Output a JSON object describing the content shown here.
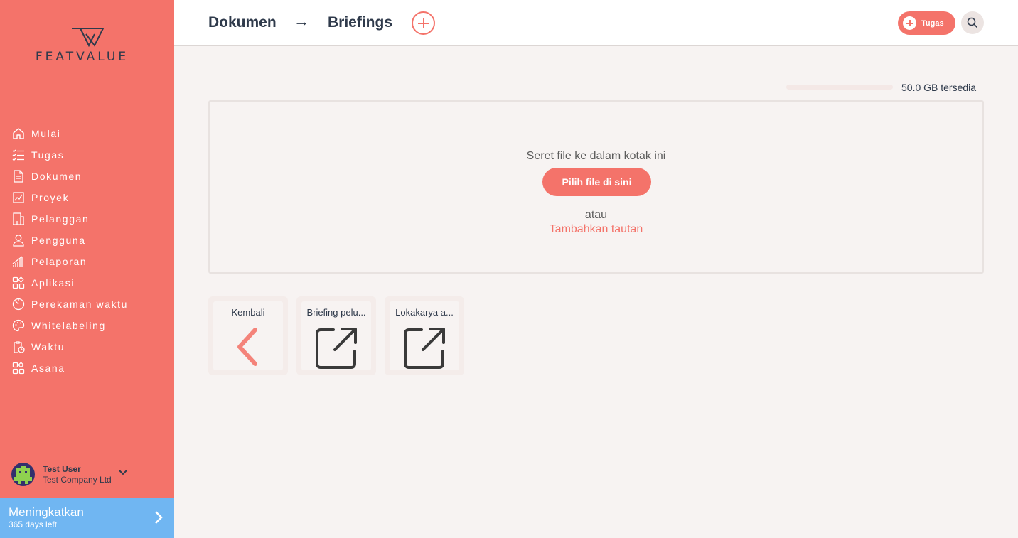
{
  "app": {
    "logo_text": "FEATVALUE",
    "accent_color": "#f4736a",
    "sidebar_color": "#f4736a",
    "upgrade_color": "#70b6f2"
  },
  "sidebar": {
    "items": [
      {
        "label": "Mulai",
        "icon": "home-icon"
      },
      {
        "label": "Tugas",
        "icon": "checklist-icon"
      },
      {
        "label": "Dokumen",
        "icon": "document-icon"
      },
      {
        "label": "Proyek",
        "icon": "chart-icon"
      },
      {
        "label": "Pelanggan",
        "icon": "building-icon"
      },
      {
        "label": "Pengguna",
        "icon": "user-icon"
      },
      {
        "label": "Pelaporan",
        "icon": "bars-icon"
      },
      {
        "label": "Aplikasi",
        "icon": "apps-icon"
      },
      {
        "label": "Perekaman waktu",
        "icon": "timer-icon"
      },
      {
        "label": "Whitelabeling",
        "icon": "palette-icon"
      },
      {
        "label": "Waktu",
        "icon": "clipboard-clock-icon"
      },
      {
        "label": "Asana",
        "icon": "apps-icon"
      }
    ],
    "user": {
      "name": "Test User",
      "company": "Test Company Ltd"
    },
    "upgrade": {
      "title": "Meningkatkan",
      "subtitle": "365 days left"
    }
  },
  "header": {
    "breadcrumb": [
      "Dokumen",
      "Briefings"
    ],
    "breadcrumb_separator": "→",
    "task_button": "Tugas"
  },
  "storage": {
    "text": "50.0 GB tersedia"
  },
  "dropzone": {
    "hint": "Seret file ke dalam kotak ini",
    "pick_button": "Pilih file di sini",
    "or": "atau",
    "add_link": "Tambahkan tautan"
  },
  "tiles": [
    {
      "label": "Kembali",
      "icon": "chevron-left-icon"
    },
    {
      "label": "Briefing pelu...",
      "icon": "external-link-icon"
    },
    {
      "label": "Lokakarya a...",
      "icon": "external-link-icon"
    }
  ]
}
